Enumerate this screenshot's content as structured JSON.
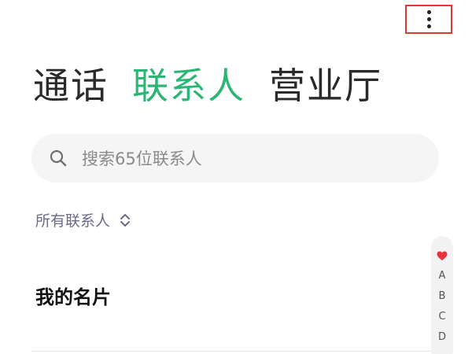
{
  "tabs": [
    {
      "label": "通话",
      "active": false
    },
    {
      "label": "联系人",
      "active": true
    },
    {
      "label": "营业厅",
      "active": false
    }
  ],
  "colors": {
    "accent": "#2bb673",
    "annotation": "#e0392f"
  },
  "search": {
    "placeholder": "搜索65位联系人",
    "icon": "search-icon"
  },
  "filter": {
    "label": "所有联系人",
    "icon": "chevron-up-down-icon"
  },
  "my_card": {
    "title": "我的名片"
  },
  "index": {
    "favorite_icon": "heart-icon",
    "letters": [
      "A",
      "B",
      "C",
      "D"
    ]
  },
  "toolbar": {
    "more_icon": "more-vertical-icon"
  }
}
